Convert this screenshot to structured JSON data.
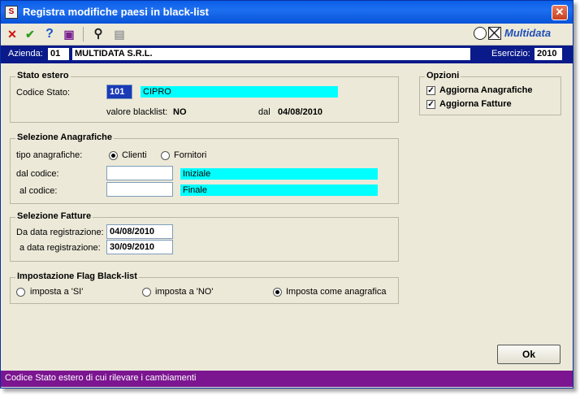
{
  "window": {
    "title": "Registra modifiche paesi in black-list",
    "app_icon": "S",
    "close_glyph": "✕"
  },
  "toolbar": {
    "cancel_glyph": "✕",
    "confirm_glyph": "✔",
    "help_glyph": "?",
    "book_glyph": "▣",
    "search_glyph": "⚲",
    "print_glyph": "▤"
  },
  "logo": {
    "text": "Multidata"
  },
  "company": {
    "azienda_label": "Azienda:",
    "azienda_code": "01",
    "azienda_name": "MULTIDATA S.R.L.",
    "esercizio_label": "Esercizio:",
    "esercizio_value": "2010"
  },
  "stato_estero": {
    "title": "Stato estero",
    "codice_label": "Codice Stato:",
    "codice_value": "101",
    "paese_value": "CIPRO",
    "valore_label": "valore blacklist:",
    "valore_value": "NO",
    "dal_label": "dal",
    "dal_value": "04/08/2010"
  },
  "opzioni": {
    "title": "Opzioni",
    "items": [
      {
        "label": "Aggiorna Anagrafiche",
        "checked": true
      },
      {
        "label": "Aggiorna Fatture",
        "checked": true
      }
    ],
    "check_glyph": "✓"
  },
  "anagrafiche": {
    "title": "Selezione Anagrafiche",
    "tipo_label": "tipo anagrafiche:",
    "radio_clienti": "Clienti",
    "radio_fornitori": "Fornitori",
    "dal_label": "dal codice:",
    "dal_value": "",
    "dal_desc": "Iniziale",
    "al_label": "al codice:",
    "al_value": "",
    "al_desc": "Finale"
  },
  "fatture": {
    "title": "Selezione Fatture",
    "da_label": "Da data registrazione:",
    "da_value": "04/08/2010",
    "a_label": "a data registrazione:",
    "a_value": "30/09/2010"
  },
  "flag": {
    "title": "Impostazione Flag Black-list",
    "opt_si": "imposta a 'SI'",
    "opt_no": "imposta a 'NO'",
    "opt_anag": "Imposta come anagrafica"
  },
  "ok_label": "Ok",
  "status": "Codice Stato estero di cui rilevare i cambiamenti"
}
